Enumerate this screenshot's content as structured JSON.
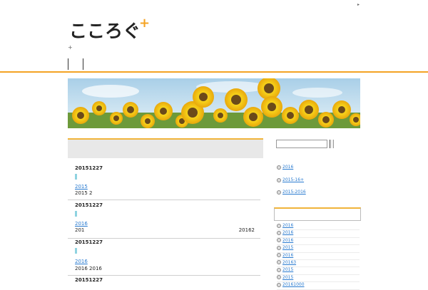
{
  "header": {
    "top_marker": "▸",
    "logo_text": "こころぐ",
    "logo_plus": "+",
    "sub_plus": "+"
  },
  "colors": {
    "accent_orange": "#f4a324",
    "link_blue": "#2a7bd0",
    "tag_cyan": "#8fd3e0"
  },
  "banner": {
    "subject": "sunflower field under blue sky"
  },
  "entries": [
    {
      "date": "20151227",
      "link": "2015",
      "text": "2015  2",
      "text_right": ""
    },
    {
      "date": "20151227",
      "link": "2016",
      "text": "201",
      "text_right": "20162"
    },
    {
      "date": "20151227",
      "link": "2016",
      "text": "2016 2016",
      "text_right": ""
    },
    {
      "date": "20151227",
      "link": "",
      "text": "",
      "text_right": ""
    }
  ],
  "sidebar": {
    "search_placeholder": "",
    "top_links": [
      "2016",
      "2015-16+",
      "2015-2016"
    ],
    "list": [
      "2016",
      "2016",
      "2016",
      "2015",
      "2016",
      "20163",
      "2015",
      "2015",
      "20161000"
    ]
  }
}
